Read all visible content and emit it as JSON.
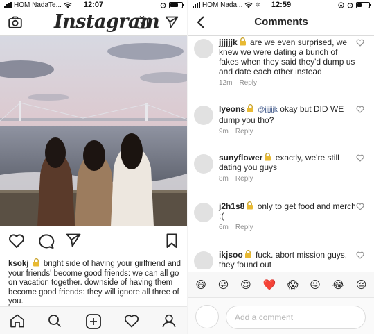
{
  "status_left": {
    "carrier": "HOM NadaTe...",
    "time": "12:07"
  },
  "status_right": {
    "carrier": "HOM Nada...",
    "time": "12:59"
  },
  "feed": {
    "logo_text": "Instagram",
    "post": {
      "username": "ksokj",
      "caption": "bright side of having your girlfriend and your friends' become good friends: we can all go on vacation together. downside of having them become good friends: they will ignore all three of you."
    }
  },
  "comments_screen": {
    "title": "Comments",
    "reply_label": "Reply",
    "comments": [
      {
        "username": "jjjjjjk",
        "text": "are we even surprised, we knew we were dating a bunch of fakes when they said they'd dump us and date each other instead",
        "mention": "",
        "time": "12m"
      },
      {
        "username": "lyeons",
        "text": "okay but DID WE dump you tho?",
        "mention": "@jjjjjjk",
        "time": "9m"
      },
      {
        "username": "sunyflower",
        "text": "exactly, we're still dating you guys",
        "mention": "",
        "time": "8m"
      },
      {
        "username": "j2h1s8",
        "text": "only to get food and merch :(",
        "mention": "",
        "time": "6m"
      },
      {
        "username": "ikjsoo",
        "text": "fuck. abort mission guys, they found out",
        "mention": "",
        "time": ""
      }
    ],
    "emojis": [
      "😄",
      "😜",
      "😍",
      "❤️",
      "😱",
      "😛",
      "😂",
      "😔"
    ],
    "input_placeholder": "Add a comment"
  }
}
